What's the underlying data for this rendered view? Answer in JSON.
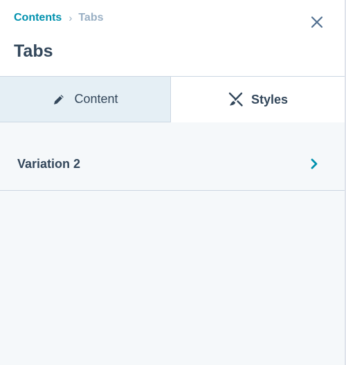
{
  "breadcrumb": {
    "parent": "Contents",
    "separator": "›",
    "current": "Tabs"
  },
  "header": {
    "title": "Tabs",
    "close_icon": "close-icon"
  },
  "tabs": [
    {
      "label": "Content",
      "icon": "pencil-icon",
      "active": false
    },
    {
      "label": "Styles",
      "icon": "brush-icon",
      "active": true
    }
  ],
  "rows": [
    {
      "label": "Variation 2",
      "icon": "chevron-right-icon"
    }
  ],
  "colors": {
    "accent": "#0091ae",
    "text": "#33475b",
    "muted": "#99afc4",
    "border": "#cbd6e2",
    "tab_inactive_bg": "#e5eff5",
    "panel_bg": "#f5f8fa"
  }
}
